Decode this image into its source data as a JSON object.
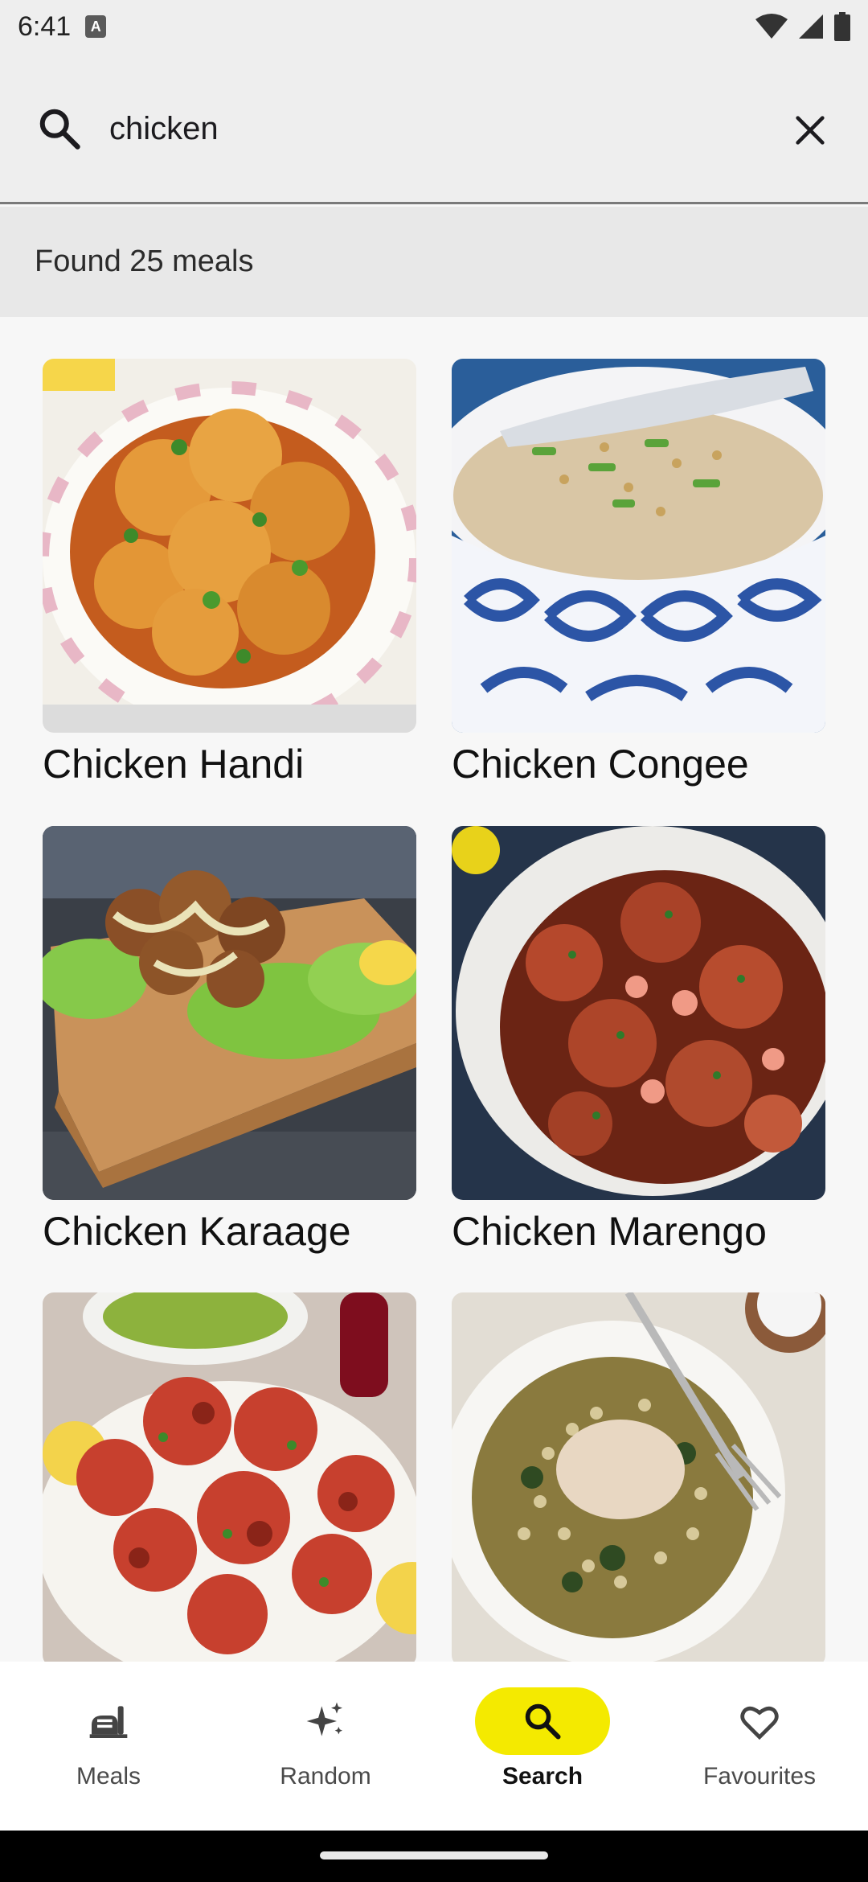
{
  "status_bar": {
    "time": "6:41",
    "sim_icon": "sim-card-icon",
    "wifi_icon": "wifi-icon",
    "signal_icon": "signal-icon",
    "battery_icon": "battery-icon"
  },
  "search": {
    "value": "chicken",
    "placeholder": "",
    "search_icon": "search-icon",
    "clear_icon": "close-icon"
  },
  "results": {
    "summary": "Found 25 meals"
  },
  "meals": [
    {
      "title": "Chicken Handi",
      "image": "chicken-handi-photo"
    },
    {
      "title": "Chicken Congee",
      "image": "chicken-congee-photo"
    },
    {
      "title": "Chicken Karaage",
      "image": "chicken-karaage-photo"
    },
    {
      "title": "Chicken Marengo",
      "image": "chicken-marengo-photo"
    },
    {
      "title": "",
      "image": "tandoori-chicken-photo"
    },
    {
      "title": "",
      "image": "chicken-couscous-photo"
    }
  ],
  "bottom_nav": {
    "items": [
      {
        "label": "Meals",
        "icon": "meals-icon",
        "active": false
      },
      {
        "label": "Random",
        "icon": "sparkle-icon",
        "active": false
      },
      {
        "label": "Search",
        "icon": "search-icon",
        "active": true
      },
      {
        "label": "Favourites",
        "icon": "heart-icon",
        "active": false
      }
    ]
  },
  "colors": {
    "accent": "#f4ea00",
    "search_bar_bg": "#eeeeee",
    "results_header_bg": "#e8e8e8"
  }
}
